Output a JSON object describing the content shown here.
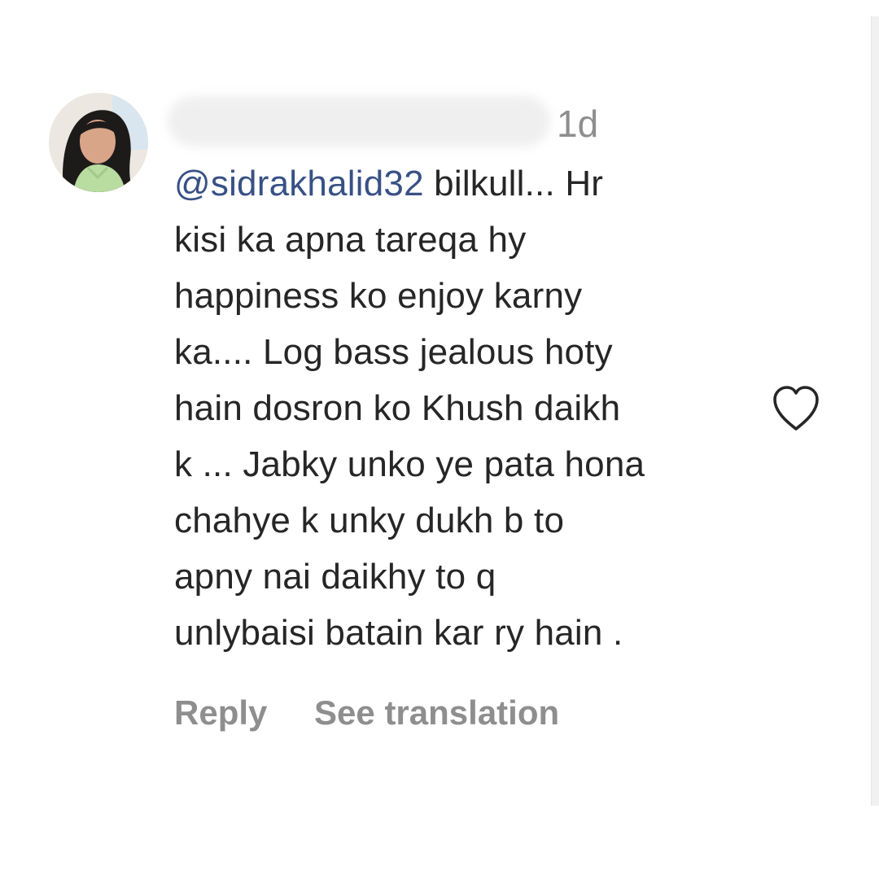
{
  "comment": {
    "timestamp": "1d",
    "mention": "@sidrakhalid32",
    "lines": [
      " bilkull... Hr",
      "kisi ka apna tareqa hy",
      "happiness ko enjoy karny",
      "ka.... Log bass jealous hoty",
      "hain dosron ko Khush daikh",
      "k ... Jabky unko ye pata hona",
      "chahye k unky dukh b to",
      "apny nai daikhy to q",
      "unlybaisi batain kar ry hain ."
    ],
    "actions": {
      "reply_label": "Reply",
      "translation_label": "See translation"
    },
    "like_icon": "heart-outline-icon",
    "colors": {
      "text": "#262626",
      "mention": "#385185",
      "muted": "#8e8e8e"
    }
  }
}
